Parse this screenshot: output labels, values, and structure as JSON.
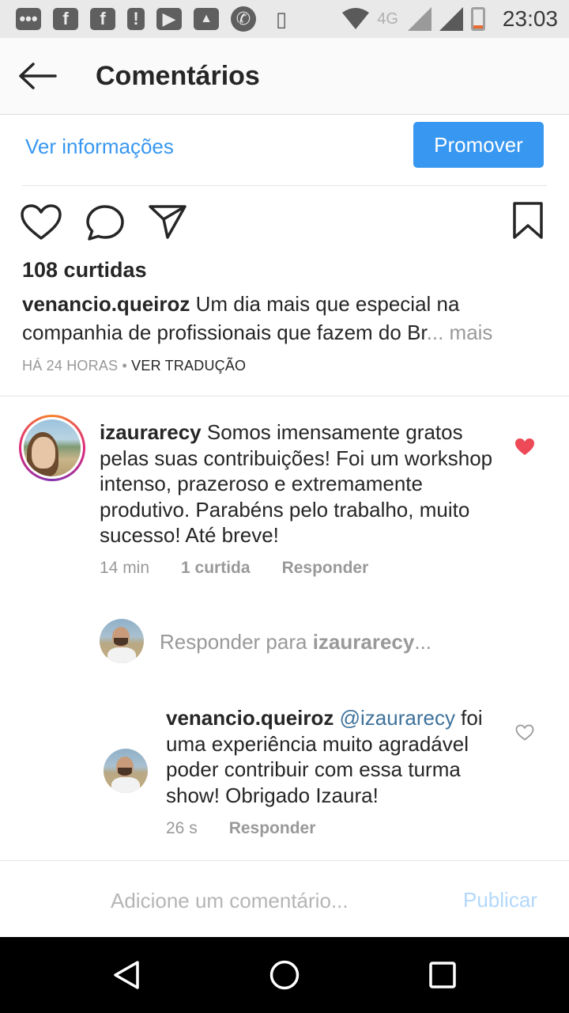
{
  "status_bar": {
    "network": "4G",
    "time": "23:03",
    "icons": [
      "messages-icon",
      "facebook-icon",
      "facebook-icon",
      "alert-icon",
      "youtube-icon",
      "gallery-icon",
      "whatsapp-icon",
      "vibrate-icon",
      "wifi-icon",
      "signal-icon",
      "signal-icon",
      "battery-icon"
    ]
  },
  "header": {
    "title": "Comentários"
  },
  "promo": {
    "ver_info_label": "Ver informações",
    "promover_label": "Promover"
  },
  "post": {
    "likes": "108 curtidas",
    "author": "venancio.queiroz",
    "caption": " Um dia mais que especial na companhia de profissionais que fazem do Br",
    "ellipsis": "...",
    "more": " mais",
    "time": "HÁ 24 HORAS",
    "separator": " • ",
    "translate": "VER TRADUÇÃO"
  },
  "comments": [
    {
      "user": "izaurarecy",
      "text": " Somos imensamente gratos pelas suas contribuições! Foi um workshop intenso, prazeroso e extremamente produtivo. Parabéns pelo trabalho, muito sucesso! Até breve!",
      "time": "14 min",
      "likes": "1 curtida",
      "reply_label": "Responder",
      "liked": true
    },
    {
      "user": "venancio.queiroz",
      "mention": "@izaurarecy",
      "text": " foi uma experiência muito agradável poder contribuir com essa turma show! Obrigado Izaura!",
      "time": "26 s",
      "reply_label": "Responder",
      "liked": false
    }
  ],
  "reply_prompt": {
    "prefix": "Responder para ",
    "user": "izaurarecy",
    "suffix": "..."
  },
  "composer": {
    "placeholder": "Adicione um comentário...",
    "publish_label": "Publicar"
  },
  "colors": {
    "accent": "#3897f0",
    "liked_heart": "#ed4956",
    "muted": "#999999"
  }
}
